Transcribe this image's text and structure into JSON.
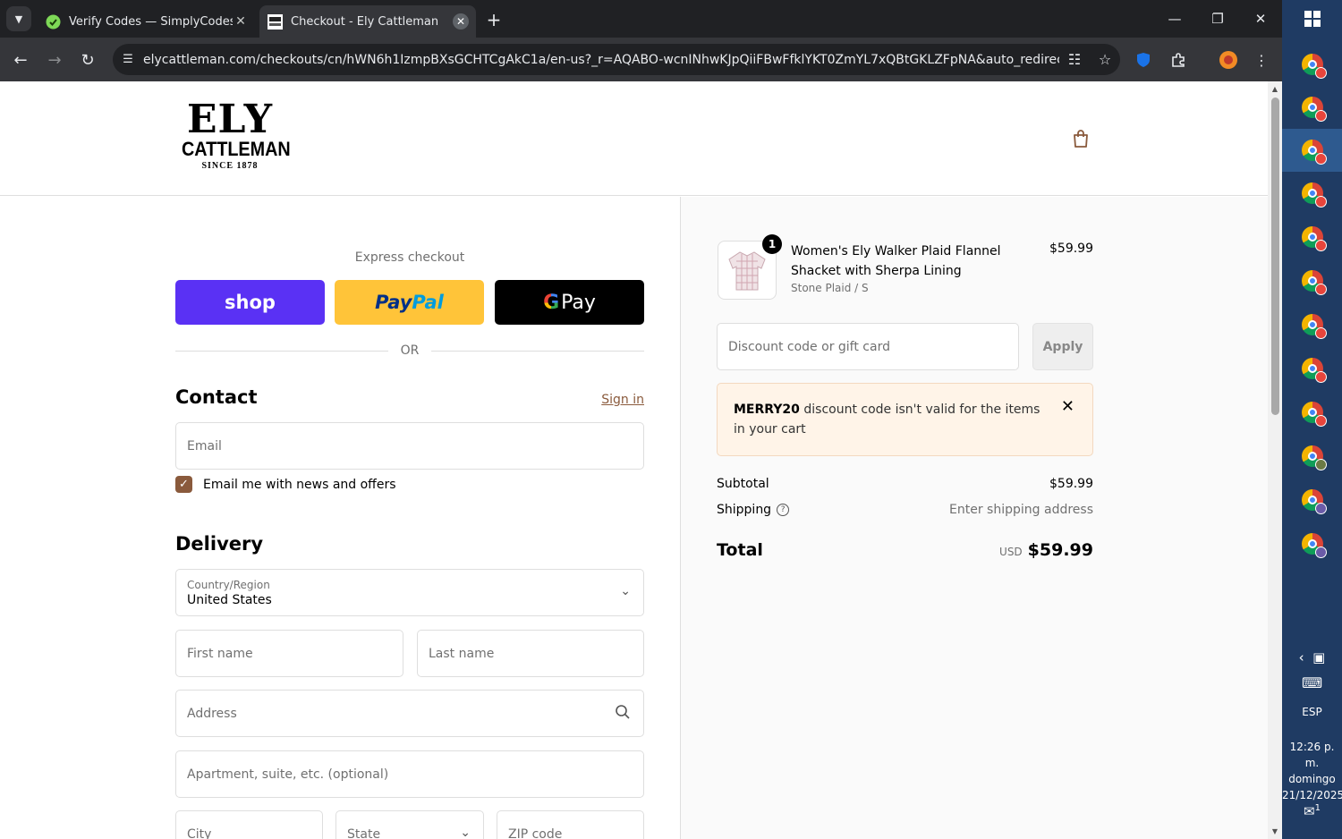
{
  "browser": {
    "tabs": [
      {
        "title": "Verify Codes — SimplyCodes",
        "active": false
      },
      {
        "title": "Checkout - Ely Cattleman",
        "active": true
      }
    ],
    "url": "elycattleman.com/checkouts/cn/hWN6h1IzmpBXsGCHTCgAkC1a/en-us?_r=AQABO-wcnINhwKJpQiiFBwFfklYKT0ZmYL7xQBtGKLZFpNA&auto_redirect=fals..."
  },
  "taskbar": {
    "language": "ESP",
    "time": "12:26 p. m.",
    "day": "domingo",
    "date": "21/12/2025",
    "notifications": "1"
  },
  "header": {
    "logo_line1": "ELY",
    "logo_line2": "CATTLEMAN",
    "logo_line3": "SINCE 1878"
  },
  "checkout": {
    "express_label": "Express checkout",
    "shop_label": "shop",
    "paypal_label_1": "Pay",
    "paypal_label_2": "Pal",
    "gpay_g": "G",
    "gpay_label": "Pay",
    "or_label": "OR",
    "contact_title": "Contact",
    "sign_in": "Sign in",
    "email_placeholder": "Email",
    "newsletter_label": "Email me with news and offers",
    "delivery_title": "Delivery",
    "country_label": "Country/Region",
    "country_value": "United States",
    "first_name_placeholder": "First name",
    "last_name_placeholder": "Last name",
    "address_placeholder": "Address",
    "apartment_placeholder": "Apartment, suite, etc. (optional)",
    "city_placeholder": "City",
    "state_placeholder": "State",
    "zip_placeholder": "ZIP code"
  },
  "summary": {
    "item": {
      "quantity": "1",
      "name": "Women's Ely Walker Plaid Flannel Shacket with Sherpa Lining",
      "variant": "Stone Plaid / S",
      "price": "$59.99"
    },
    "discount_placeholder": "Discount code or gift card",
    "apply_label": "Apply",
    "alert_code": "MERRY20",
    "alert_text": " discount code isn't valid for the items in your cart",
    "subtotal_label": "Subtotal",
    "subtotal_value": "$59.99",
    "shipping_label": "Shipping",
    "shipping_value": "Enter shipping address",
    "total_label": "Total",
    "total_currency": "USD",
    "total_value": "$59.99"
  }
}
